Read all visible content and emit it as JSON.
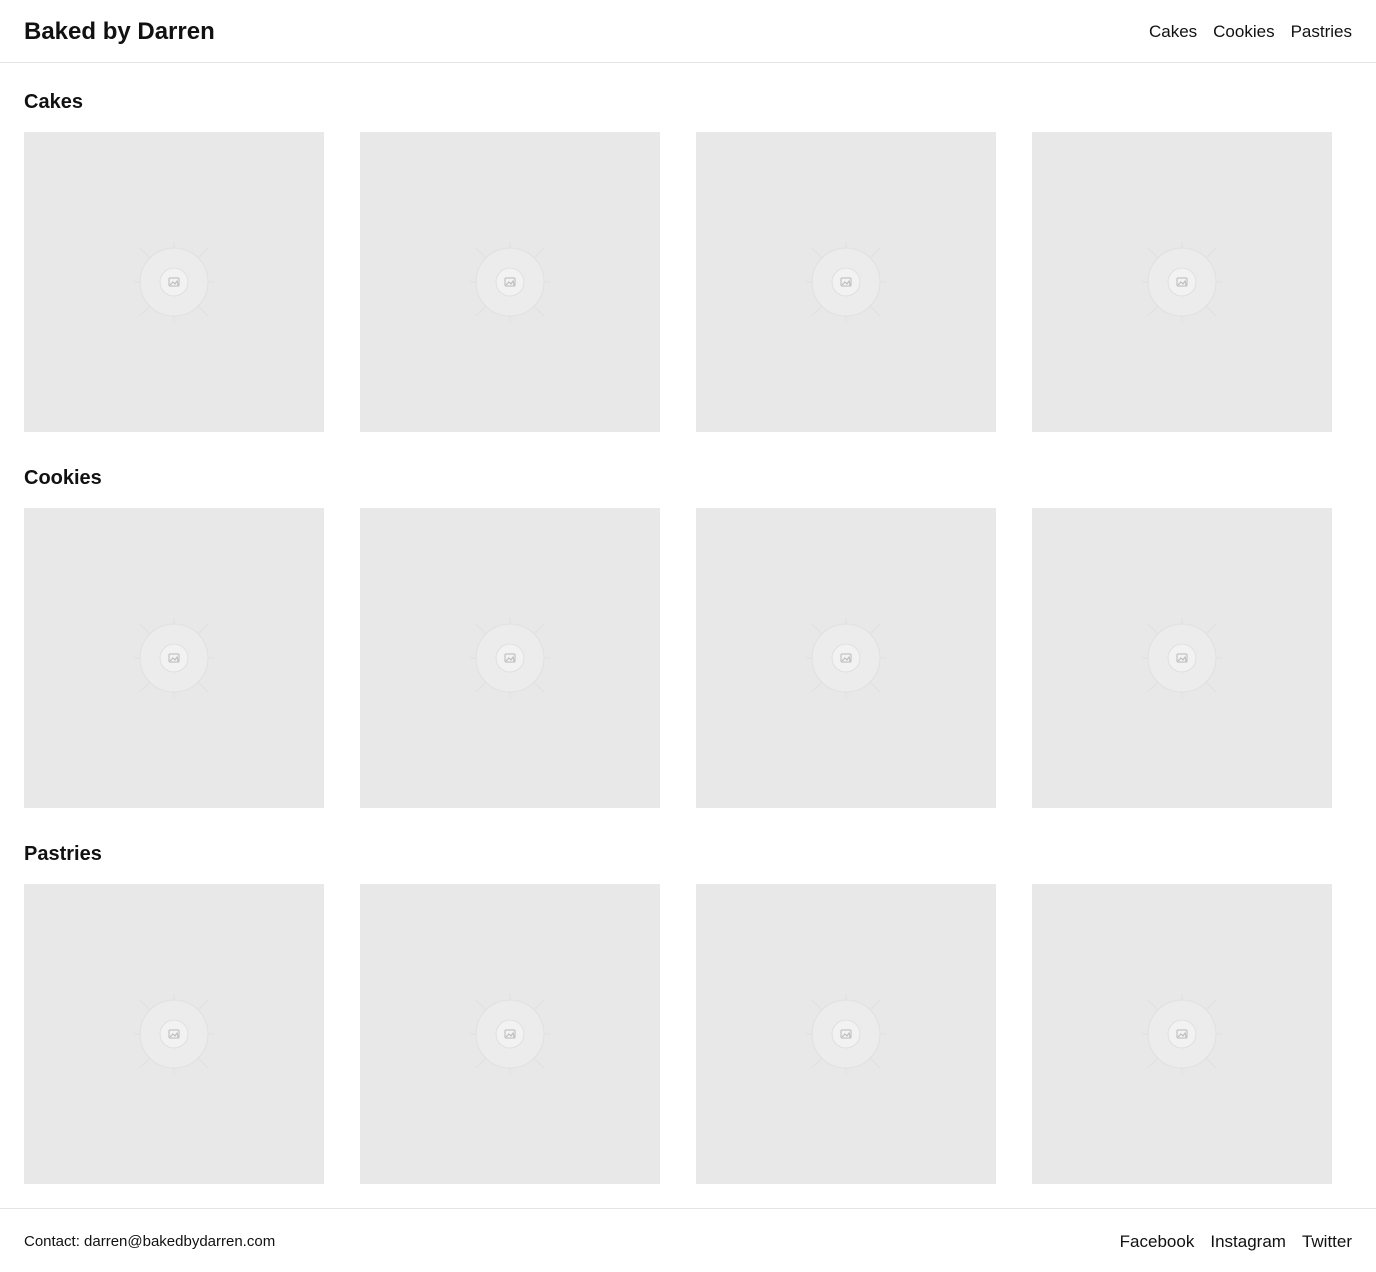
{
  "header": {
    "site_title": "Baked by Darren",
    "nav": [
      {
        "label": "Cakes"
      },
      {
        "label": "Cookies"
      },
      {
        "label": "Pastries"
      }
    ]
  },
  "sections": [
    {
      "title": "Cakes",
      "items": [
        "image-placeholder",
        "image-placeholder",
        "image-placeholder",
        "image-placeholder"
      ]
    },
    {
      "title": "Cookies",
      "items": [
        "image-placeholder",
        "image-placeholder",
        "image-placeholder",
        "image-placeholder"
      ]
    },
    {
      "title": "Pastries",
      "items": [
        "image-placeholder",
        "image-placeholder",
        "image-placeholder",
        "image-placeholder"
      ]
    }
  ],
  "footer": {
    "contact": "Contact: darren@bakedbydarren.com",
    "links": [
      {
        "label": "Facebook"
      },
      {
        "label": "Instagram"
      },
      {
        "label": "Twitter"
      }
    ]
  },
  "colors": {
    "background": "#ffffff",
    "tile": "#e8e8e8",
    "divider": "#e4e4e4",
    "text": "#111111"
  }
}
